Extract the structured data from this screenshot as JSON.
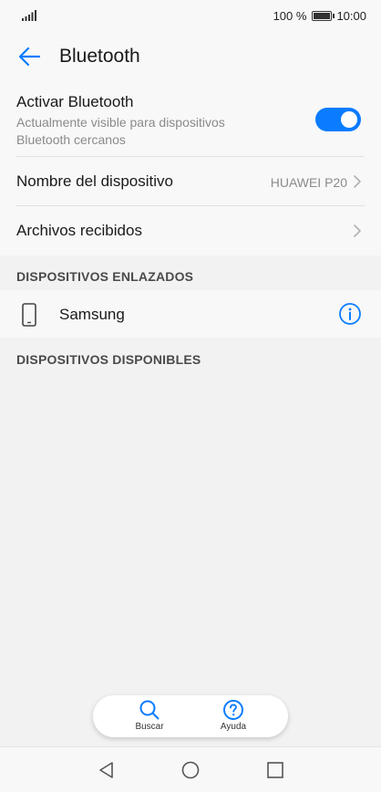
{
  "status_bar": {
    "battery_percent": "100 %",
    "time": "10:00"
  },
  "header": {
    "title": "Bluetooth"
  },
  "bluetooth": {
    "title": "Activar Bluetooth",
    "subtitle": "Actualmente visible para dispositivos Bluetooth cercanos",
    "enabled": true
  },
  "settings": {
    "device_name_label": "Nombre del dispositivo",
    "device_name_value": "HUAWEI P20",
    "received_files_label": "Archivos recibidos"
  },
  "paired_section": {
    "header": "DISPOSITIVOS ENLAZADOS",
    "devices": [
      {
        "name": "Samsung"
      }
    ]
  },
  "available_section": {
    "header": "DISPOSITIVOS DISPONIBLES"
  },
  "bottom_actions": {
    "search_label": "Buscar",
    "help_label": "Ayuda"
  },
  "colors": {
    "accent": "#0a7cff",
    "background": "#f2f2f2",
    "surface": "#f8f8f8"
  },
  "icons": {
    "back": "arrow-left-icon",
    "info": "info-circle-icon",
    "search": "search-icon",
    "help": "question-circle-icon",
    "device": "smartphone-icon"
  }
}
